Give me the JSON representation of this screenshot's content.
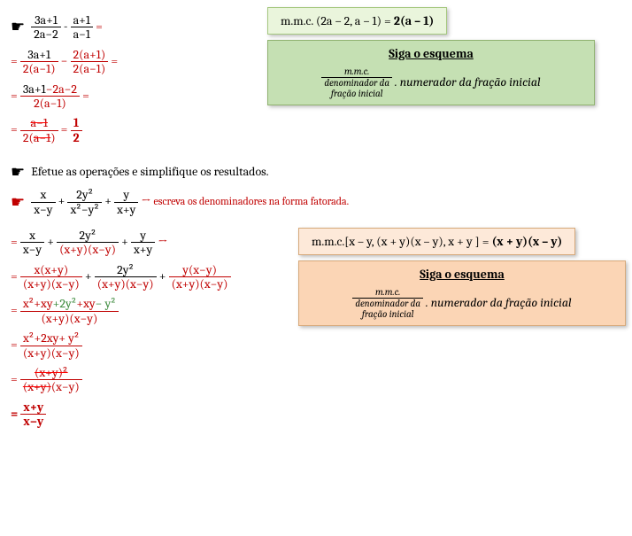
{
  "ex1": {
    "p1_num": "3a+1",
    "p1_den": "2a−2",
    "minus": " - ",
    "p2_num": "a+1",
    "p2_den": "a−1",
    "eq": " =",
    "eq_pre": "= ",
    "s1a_num": "3a+1",
    "s1a_den": "2(a−1)",
    "s1_mid": " − ",
    "s1b_num": "2(a+1)",
    "s1b_den": "2(a−1)",
    "s2_num_a": "3a+1",
    "s2_num_b": "−2a−2",
    "s2_den": "2(a−1)",
    "s3_num": "a−1",
    "s3_den_a": "2(",
    "s3_den_b": "a−1",
    "s3_den_c": ")",
    "res_eq": " = ",
    "res_num": "1",
    "res_den": "2",
    "mmc_label": "m.m.c. (2a – 2, a – 1) = ",
    "mmc_res": "2(a – 1)",
    "scheme_title": "Siga o esquema",
    "scheme_frac_num": "m.m.c.",
    "scheme_frac_den1": "denominador da",
    "scheme_frac_den2": "fração inicial",
    "scheme_tail": " . numerador da fração inicial"
  },
  "ex2": {
    "instruction": "Efetue as operações e simplifique os resultados.",
    "t1_num": "x",
    "t1_den": "x−y",
    "plus": " + ",
    "t2_num": "2y²",
    "t2_den": "x²−y²",
    "t3_num": "y",
    "t3_den": "x+y",
    "hint_arrow": " → ",
    "hint": "escreva os denominadores na forma fatorada.",
    "eq_pre": "= ",
    "eq": " =",
    "arrow": " →",
    "s1a_num": "x",
    "s1a_den": "x−y",
    "s1b_num": "2y²",
    "s1b_den": "(x+y)(x−y)",
    "s1c_num": "y",
    "s1c_den": "x+y",
    "s2a_num": "x(x+y)",
    "s2a_den": "(x+y)(x−y)",
    "s2b_num": "2y²",
    "s2b_den": "(x+y)(x−y)",
    "s2c_num": "y(x−y)",
    "s2c_den": "(x+y)(x−y)",
    "s3_num_a": "x²+xy",
    "s3_num_b": "+2y²",
    "s3_num_c": "+xy",
    "s3_num_d": "− y²",
    "s3_den": "(x+y)(x−y)",
    "s4_num": "x²+2xy+ y²",
    "s4_den": "(x+y)(x−y)",
    "s5_num": "(x+y)²",
    "s5_den_a": "(x+y)",
    "s5_den_b": "(x−y)",
    "res_num": "x+y",
    "res_den": "x−y",
    "mmc_label": "m.m.c.[x – y, (x + y)(x – y), x + y ] = ",
    "mmc_res": "(x + y)(x – y)",
    "scheme_title": "Siga o esquema",
    "scheme_frac_num": "m.m.c.",
    "scheme_frac_den1": "denominador da",
    "scheme_frac_den2": "fração inicial",
    "scheme_tail": " . numerador da fração inicial"
  }
}
